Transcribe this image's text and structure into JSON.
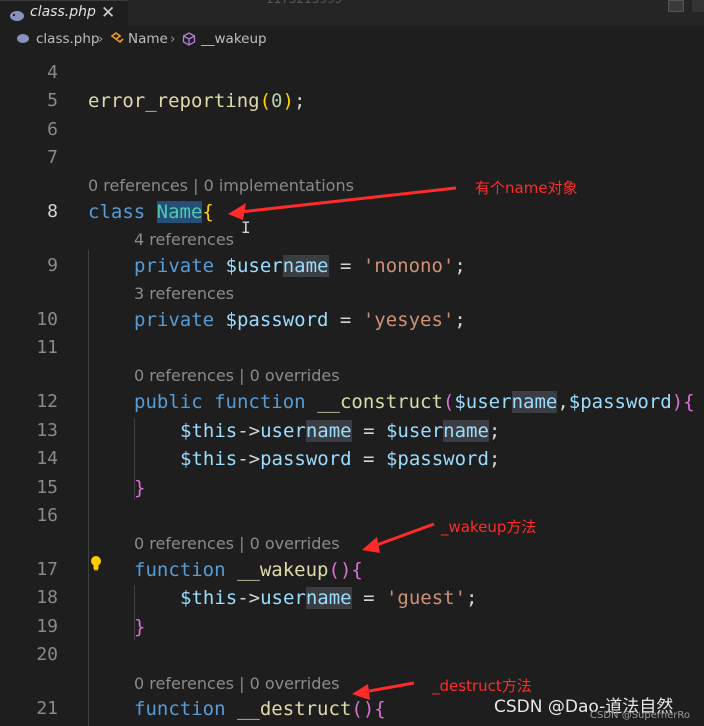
{
  "tab": {
    "filename": "class.php",
    "close": "✕",
    "icon": "php-elephant-icon"
  },
  "window_title_faded": "1175215999",
  "breadcrumb": {
    "file": "class.php",
    "class": "Name",
    "method": "__wakeup"
  },
  "lines": [
    {
      "num": "4",
      "text": ""
    },
    {
      "num": "5",
      "text": "error_reporting(0);"
    },
    {
      "num": "6",
      "text": ""
    },
    {
      "num": "7",
      "text": ""
    },
    {
      "num": "8",
      "text": "class Name{",
      "lens": "0 references | 0 implementations"
    },
    {
      "num": "9",
      "text": "private $username = 'nonono';",
      "lens": "4 references"
    },
    {
      "num": "10",
      "text": "private $password = 'yesyes';",
      "lens": "3 references"
    },
    {
      "num": "11",
      "text": ""
    },
    {
      "num": "12",
      "text": "public function __construct($username,$password){",
      "lens": "0 references | 0 overrides"
    },
    {
      "num": "13",
      "text": "$this->username = $username;"
    },
    {
      "num": "14",
      "text": "$this->password = $password;"
    },
    {
      "num": "15",
      "text": "}"
    },
    {
      "num": "16",
      "text": ""
    },
    {
      "num": "17",
      "text": "function __wakeup(){",
      "lens": "0 references | 0 overrides"
    },
    {
      "num": "18",
      "text": "$this->username = 'guest';"
    },
    {
      "num": "19",
      "text": "}"
    },
    {
      "num": "20",
      "text": ""
    },
    {
      "num": "21",
      "text": "function __destruct(){",
      "lens": "0 references | 0 overrides"
    }
  ],
  "annotations": {
    "name_object": "有个name对象",
    "wakeup_method": "_wakeup方法",
    "destruct_method": "_destruct方法",
    "color": "#ff2b2b"
  },
  "watermark": "CSDN @Dao-道法自然",
  "watermark_small": "CSDN @SuperherRo",
  "theme": {
    "background": "#1e1e1e",
    "keyword": "#569cd6",
    "function": "#dcdcaa",
    "class": "#4ec9b0",
    "variable": "#9cdcfe",
    "string": "#ce9178",
    "lightbulb": "#ffcc00"
  }
}
